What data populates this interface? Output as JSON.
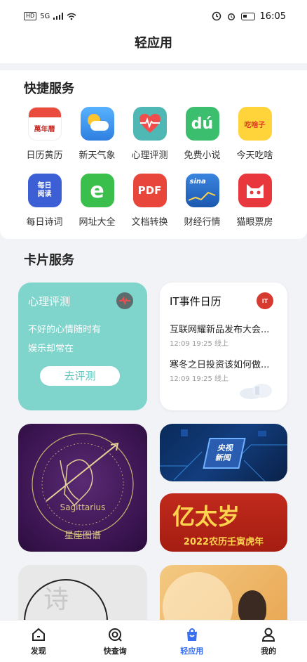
{
  "status_bar": {
    "network": "5G",
    "time": "16:05"
  },
  "header": {
    "title": "轻应用"
  },
  "quick_services": {
    "title": "快捷服务",
    "items": [
      {
        "label": "日历黄历",
        "icon": "calendar-icon",
        "color": "#e94b3c",
        "glyph": "萬年曆"
      },
      {
        "label": "新天气象",
        "icon": "weather-icon",
        "color": "#3d98ec",
        "glyph": ""
      },
      {
        "label": "心理评测",
        "icon": "heartbeat-icon",
        "color": "#4fb7b4",
        "glyph": ""
      },
      {
        "label": "免费小说",
        "icon": "novel-icon",
        "color": "#3bbf6e",
        "glyph": "dú"
      },
      {
        "label": "今天吃啥",
        "icon": "food-icon",
        "color": "#ffc62a",
        "glyph": "吃啥子"
      },
      {
        "label": "每日诗词",
        "icon": "poetry-icon",
        "color": "#3c5fd6",
        "glyph": "每日阅读"
      },
      {
        "label": "网址大全",
        "icon": "browser-icon",
        "color": "#3bbf4c",
        "glyph": "e"
      },
      {
        "label": "文档转换",
        "icon": "pdf-icon",
        "color": "#e8463b",
        "glyph": "PDF"
      },
      {
        "label": "财经行情",
        "icon": "finance-icon",
        "color": "#2c6ec8",
        "glyph": "sina"
      },
      {
        "label": "猫眼票房",
        "icon": "cat-eye-icon",
        "color": "#e8383d",
        "glyph": ""
      }
    ]
  },
  "card_services": {
    "title": "卡片服务",
    "psychology": {
      "title": "心理评测",
      "line1": "不好的心情随时有",
      "line2": "娱乐却常在",
      "button": "去评测"
    },
    "it_calendar": {
      "title": "IT事件日历",
      "logo": "IT",
      "news": [
        {
          "title": "互联网耀新品发布大会...",
          "meta": "12:09 19:25 线上"
        },
        {
          "title": "寒冬之日投资该如何做...",
          "meta": "12:09 19:25 线上"
        }
      ]
    },
    "constellation": {
      "name": "Sagittarius",
      "caption": "星座图谱"
    },
    "cctv": {
      "line1": "央视",
      "line2": "新闻"
    },
    "new_year": {
      "big": "亿太岁",
      "small": "2022农历壬寅虎年"
    },
    "poem": {
      "char": "诗"
    }
  },
  "bottom_nav": [
    {
      "label": "发现",
      "icon": "home-icon",
      "active": false
    },
    {
      "label": "快查询",
      "icon": "search-icon",
      "active": false
    },
    {
      "label": "轻应用",
      "icon": "shopping-bag-icon",
      "active": true
    },
    {
      "label": "我的",
      "icon": "user-icon",
      "active": false
    }
  ]
}
